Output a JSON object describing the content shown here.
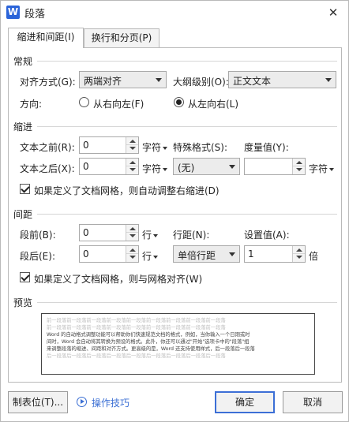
{
  "window": {
    "app_icon_letter": "W",
    "title": "段落",
    "close_glyph": "✕"
  },
  "tabs": [
    {
      "label": "缩进和间距(I)",
      "active": true
    },
    {
      "label": "换行和分页(P)",
      "active": false
    }
  ],
  "general": {
    "heading": "常规",
    "alignment_label": "对齐方式(G):",
    "alignment_value": "两端对齐",
    "outline_label": "大纲级别(O):",
    "outline_value": "正文文本",
    "direction_label": "方向:",
    "rtl_label": "从右向左(F)",
    "ltr_label": "从左向右(L)",
    "direction_selected": "ltr"
  },
  "indent": {
    "heading": "缩进",
    "before_label": "文本之前(R):",
    "before_value": "0",
    "before_unit": "字符",
    "after_label": "文本之后(X):",
    "after_value": "0",
    "after_unit": "字符",
    "special_label": "特殊格式(S):",
    "special_value": "(无)",
    "measure_label": "度量值(Y):",
    "measure_value": "",
    "measure_unit": "字符",
    "auto_adjust_label": "如果定义了文档网格，则自动调整右缩进(D)",
    "auto_adjust_checked": true
  },
  "spacing": {
    "heading": "间距",
    "before_label": "段前(B):",
    "before_value": "0",
    "before_unit": "行",
    "after_label": "段后(E):",
    "after_value": "0",
    "after_unit": "行",
    "line_label": "行距(N):",
    "line_value": "单倍行距",
    "setting_label": "设置值(A):",
    "setting_value": "1",
    "setting_unit": "倍",
    "grid_align_label": "如果定义了文档网格，则与网格对齐(W)",
    "grid_align_checked": true
  },
  "preview": {
    "heading": "预览",
    "prev_lines": [
      "前一段落前一段落前一段落前一段落前一段落前一段落前一段落前一段落前一段落",
      "前一段落前一段落前一段落前一段落前一段落前一段落前一段落前一段落前一段落"
    ],
    "sample_lines": [
      "Word 的自动格式调整功能可以帮助你们快速规范文档的格式，例如，当你输入一个日期或时",
      "间时，Word 会自动将其转换为预设的格式。此外，你还可以通过\"开始\"选项卡中的\"段落\"组",
      "来调整段落的缩进、间距和对齐方式。更高级的是，Word 还支持使用样式，后一段落后一段落"
    ],
    "next_lines": [
      "后一段落后一段落后一段落后一段落后一段落后一段落后一段落后一段落后一段落"
    ]
  },
  "footer": {
    "tab_stops_label": "制表位(T)...",
    "tips_label": "操作技巧",
    "ok_label": "确定",
    "cancel_label": "取消"
  }
}
